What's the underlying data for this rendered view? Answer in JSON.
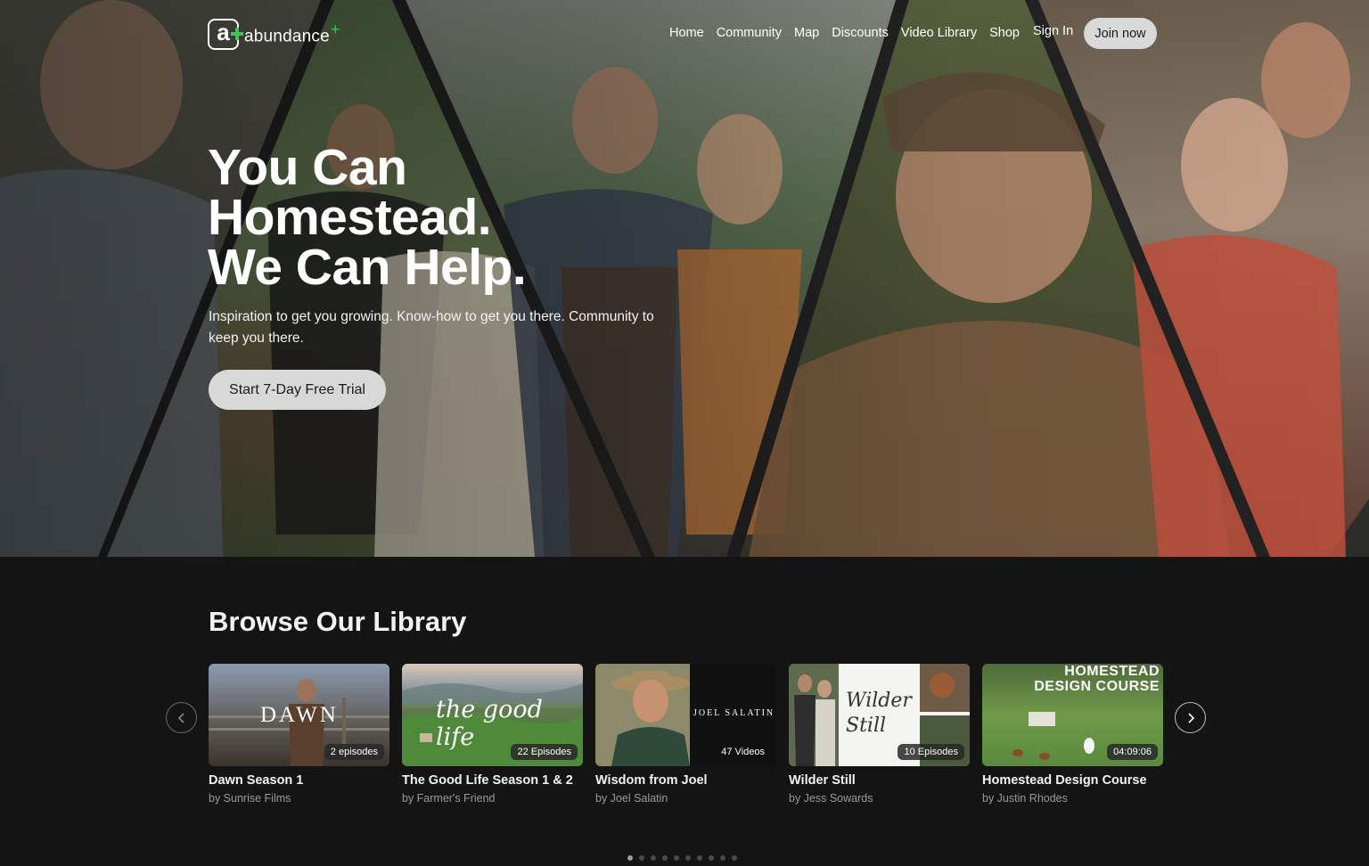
{
  "brand": {
    "name": "abundance",
    "plus": "+"
  },
  "nav": {
    "items": [
      "Home",
      "Community",
      "Map",
      "Discounts",
      "Video Library",
      "Shop"
    ],
    "sign_in": "Sign In",
    "join": "Join now"
  },
  "hero": {
    "headline": [
      "You Can",
      "Homestead.",
      "We Can Help."
    ],
    "tagline": "Inspiration to get you growing. Know-how to get you there. Community to keep you there.",
    "cta": "Start 7-Day Free Trial"
  },
  "library": {
    "title": "Browse Our Library",
    "cards": [
      {
        "title": "Dawn Season 1",
        "by": "by Sunrise Films",
        "badge": "2 episodes",
        "overlay": "DAWN"
      },
      {
        "title": "The Good Life Season 1 & 2",
        "by": "by Farmer's Friend",
        "badge": "22 Episodes",
        "overlay": "the good life"
      },
      {
        "title": "Wisdom from Joel",
        "by": "by Joel Salatin",
        "badge": "47 Videos",
        "overlay": "JOEL SALATIN"
      },
      {
        "title": "Wilder Still",
        "by": "by Jess Sowards",
        "badge": "10 Episodes",
        "overlay": "Wilder Still"
      },
      {
        "title": "Homestead Design Course",
        "by": "by Justin Rhodes",
        "badge": "04:09:06",
        "overlay": "HOMESTEAD DESIGN COURSE"
      }
    ],
    "pagination": {
      "total": 10,
      "active": 1
    }
  },
  "icons": {
    "prev": "chevron-left-icon",
    "next": "chevron-right-icon"
  },
  "colors": {
    "background": "#141414",
    "accent": "#3fc35a",
    "button": "#d9d9d9"
  }
}
